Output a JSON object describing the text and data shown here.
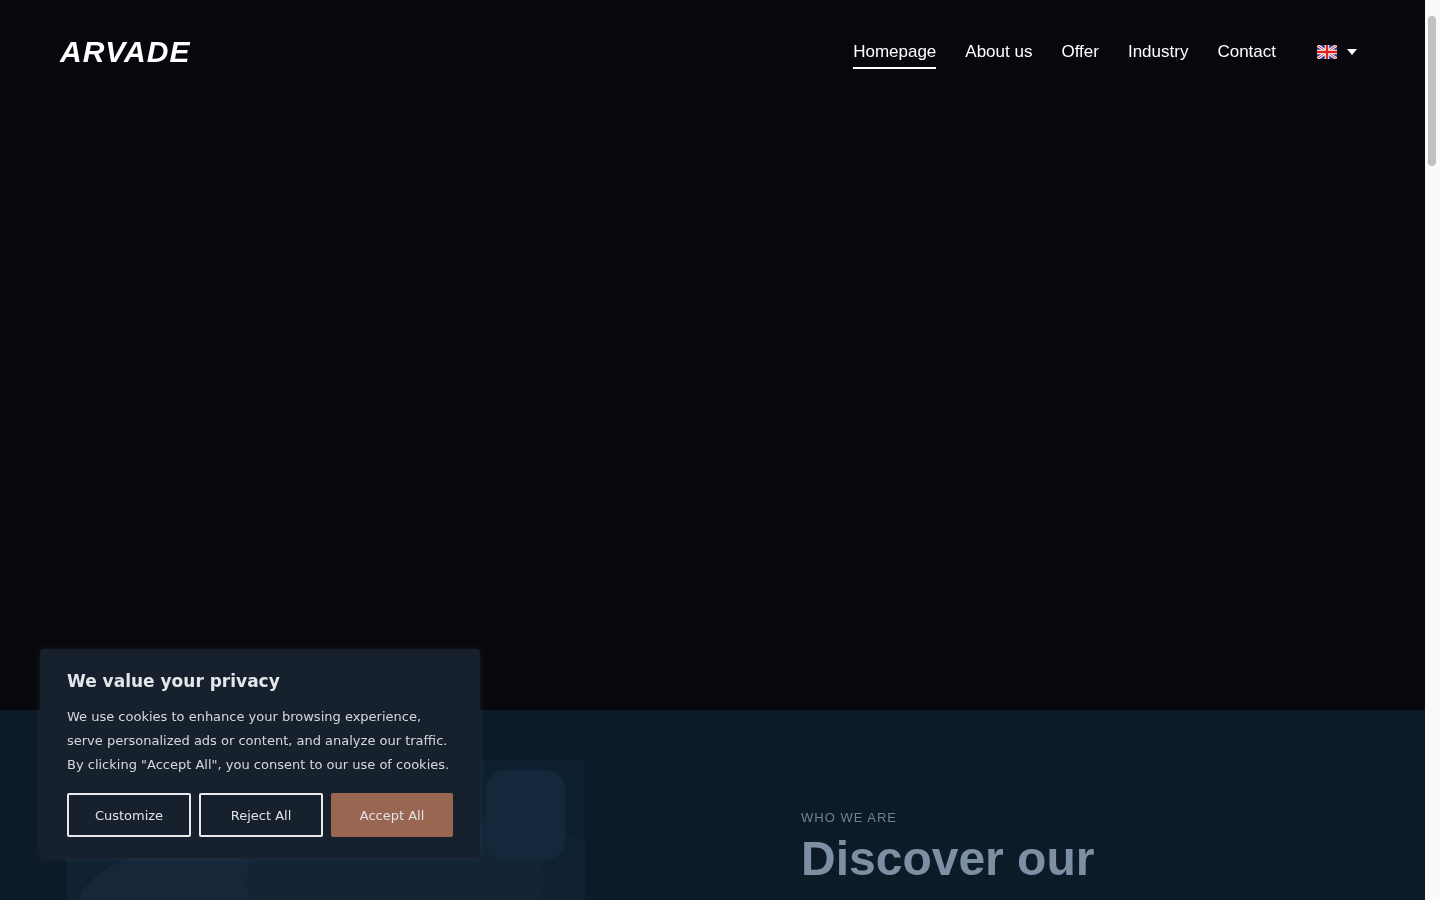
{
  "header": {
    "logo": "ARVADE",
    "nav": [
      {
        "label": "Homepage",
        "selected": true
      },
      {
        "label": "About us",
        "selected": false
      },
      {
        "label": "Offer",
        "selected": false
      },
      {
        "label": "Industry",
        "selected": false
      },
      {
        "label": "Contact",
        "selected": false
      }
    ]
  },
  "about": {
    "eyebrow": "WHO WE ARE",
    "heading": "Discover our"
  },
  "cookie_banner": {
    "title": "We value your privacy",
    "text": "We use cookies to enhance your browsing experience, serve personalized ads or content, and analyze our traffic. By clicking \"Accept All\", you consent to our use of cookies.",
    "buttons": [
      {
        "label": "Customize",
        "kind": "outline"
      },
      {
        "label": "Reject All",
        "kind": "outline"
      },
      {
        "label": "Accept All",
        "kind": "primary"
      }
    ]
  }
}
